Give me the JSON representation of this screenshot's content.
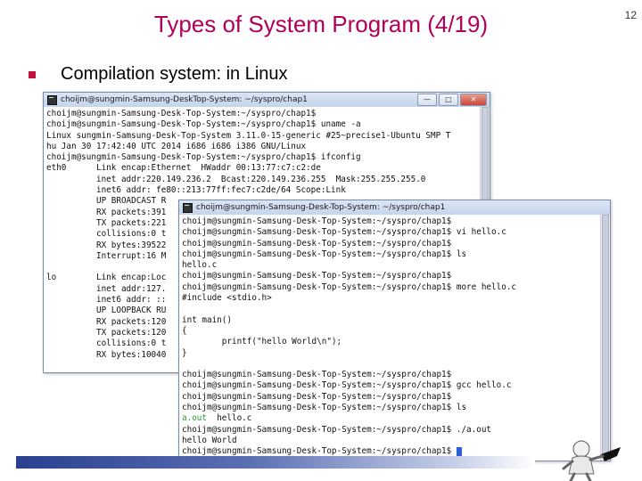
{
  "slide": {
    "title": "Types of System Program (4/19)",
    "number": "12",
    "bullet": "Compilation system: in Linux"
  },
  "window1": {
    "title": "choijm@sungmin-Samsung-DeskTop-System: ~/syspro/chap1",
    "buttons": {
      "minimize": "—",
      "maximize": "□",
      "close": "✕"
    },
    "scroll_fraction": 0.0,
    "lines": [
      "choijm@sungmin-Samsung-Desk-Top-System:~/syspro/chap1$",
      "choijm@sungmin-Samsung-Desk-Top-System:~/syspro/chap1$ uname -a",
      "Linux sungmin-Samsung-Desk-Top-System 3.11.0-15-generic #25~precise1-Ubuntu SMP T",
      "hu Jan 30 17:42:40 UTC 2014 i686 i686 i386 GNU/Linux",
      "choijm@sungmin-Samsung-Desk-Top-System:~/syspro/chap1$ ifconfig",
      "eth0      Link encap:Ethernet  HWaddr 00:13:77:c7:c2:de",
      "          inet addr:220.149.236.2  Bcast:220.149.236.255  Mask:255.255.255.0",
      "          inet6 addr: fe80::213:77ff:fec7:c2de/64 Scope:Link",
      "          UP BROADCAST R",
      "          RX packets:391",
      "          TX packets:221",
      "          collisions:0 t",
      "          RX bytes:39522",
      "          Interrupt:16 M",
      "",
      "lo        Link encap:Loc",
      "          inet addr:127.",
      "          inet6 addr: ::",
      "          UP LOOPBACK RU",
      "          RX packets:120",
      "          TX packets:120",
      "          collisions:0 t",
      "          RX bytes:10040"
    ]
  },
  "window2": {
    "title": "choijm@sungmin-Samsung-Desk-Top-System: ~/syspro/chap1",
    "buttons": {
      "minimize": "—",
      "maximize": "□",
      "close": "✕"
    },
    "scroll_fraction": 0.0,
    "lines": [
      {
        "text": "choijm@sungmin-Samsung-Desk-Top-System:~/syspro/chap1$",
        "color": ""
      },
      {
        "text": "choijm@sungmin-Samsung-Desk-Top-System:~/syspro/chap1$ vi hello.c",
        "color": ""
      },
      {
        "text": "choijm@sungmin-Samsung-Desk-Top-System:~/syspro/chap1$",
        "color": ""
      },
      {
        "text": "choijm@sungmin-Samsung-Desk-Top-System:~/syspro/chap1$ ls",
        "color": ""
      },
      {
        "text": "hello.c",
        "color": ""
      },
      {
        "text": "choijm@sungmin-Samsung-Desk-Top-System:~/syspro/chap1$",
        "color": ""
      },
      {
        "text": "choijm@sungmin-Samsung-Desk-Top-System:~/syspro/chap1$ more hello.c",
        "color": ""
      },
      {
        "text": "#include <stdio.h>",
        "color": ""
      },
      {
        "text": "",
        "color": ""
      },
      {
        "text": "int main()",
        "color": ""
      },
      {
        "text": "{",
        "color": ""
      },
      {
        "text": "        printf(\"hello World\\n\");",
        "color": ""
      },
      {
        "text": "}",
        "color": ""
      },
      {
        "text": "",
        "color": ""
      },
      {
        "text": "choijm@sungmin-Samsung-Desk-Top-System:~/syspro/chap1$",
        "color": ""
      },
      {
        "text": "choijm@sungmin-Samsung-Desk-Top-System:~/syspro/chap1$ gcc hello.c",
        "color": ""
      },
      {
        "text": "choijm@sungmin-Samsung-Desk-Top-System:~/syspro/chap1$",
        "color": ""
      },
      {
        "text": "choijm@sungmin-Samsung-Desk-Top-System:~/syspro/chap1$ ls",
        "color": ""
      },
      {
        "text": "a.out",
        "color": "#2e9a2e",
        "rest": "  hello.c"
      },
      {
        "text": "choijm@sungmin-Samsung-Desk-Top-System:~/syspro/chap1$ ./a.out",
        "color": ""
      },
      {
        "text": "hello World",
        "color": ""
      },
      {
        "text": "choijm@sungmin-Samsung-Desk-Top-System:~/syspro/chap1$ ",
        "color": "",
        "cursor": true
      }
    ]
  },
  "colors": {
    "title": "#b0005b",
    "bullet": "#c0143c",
    "executable": "#2e9a2e",
    "cursor": "#2c5fd6"
  },
  "icons": {
    "terminal": "terminal-icon",
    "bullet": "square-bullet-icon",
    "mascot": "mascot-figure-icon"
  }
}
